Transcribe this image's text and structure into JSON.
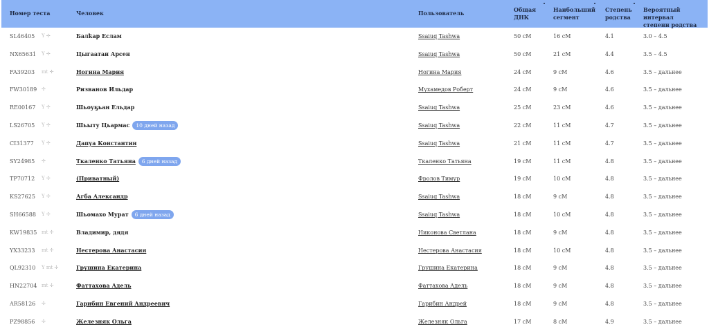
{
  "headers": {
    "test": "Номер теста",
    "person": "Человек",
    "user": "Пользователь",
    "total_l1": "Общая",
    "total_l2": "ДНК",
    "seg_l1": "Наибольший",
    "seg_l2": "сегмент",
    "deg_l1": "Степень",
    "deg_l2": "родства",
    "range_l1": "Вероятный интервал",
    "range_l2": "степени родства"
  },
  "rows": [
    {
      "test": "SL46405",
      "icons": "Y ✢",
      "person": "Балҟар Еслам",
      "link": false,
      "badge": "",
      "user": "Ssaiuq Tashwa",
      "total": "50 cM",
      "seg": "16 cM",
      "deg": "4.1",
      "range": "3.0 – 4.5"
    },
    {
      "test": "NX65631",
      "icons": "Y ✢",
      "person": "Цыгаатан Арсен",
      "link": false,
      "badge": "",
      "user": "Ssaiuq Tashwa",
      "total": "50 cM",
      "seg": "21 cM",
      "deg": "4.4",
      "range": "3.5 – 4.5"
    },
    {
      "test": "FA39203",
      "icons": "mt ✢",
      "person": "Ногина Мария",
      "link": true,
      "badge": "",
      "user": "Ногина Мария",
      "total": "24 cM",
      "seg": "9 cM",
      "deg": "4.6",
      "range": "3.5 – дальнее"
    },
    {
      "test": "FW30189",
      "icons": "✢",
      "person": "Ризванов Ильдар",
      "link": false,
      "badge": "",
      "user": "Мухамедов Роберт",
      "total": "24 cM",
      "seg": "9 cM",
      "deg": "4.6",
      "range": "3.5 – дальнее"
    },
    {
      "test": "RE00167",
      "icons": "Y ✢",
      "person": "Шьоуҕьан Ельдар",
      "link": false,
      "badge": "",
      "user": "Ssaiuq Tashwa",
      "total": "25 cM",
      "seg": "23 cM",
      "deg": "4.6",
      "range": "3.5 – дальнее"
    },
    {
      "test": "LS26705",
      "icons": "Y ✢",
      "person": "Шьыту Цьармас",
      "link": false,
      "badge": "10 дней назад",
      "user": "Ssaiuq Tashwa",
      "total": "22 cM",
      "seg": "11 cM",
      "deg": "4.7",
      "range": "3.5 – дальнее"
    },
    {
      "test": "CI31377",
      "icons": "Y ✢",
      "person": "Дапуа Константин",
      "link": true,
      "badge": "",
      "user": "Ssaiuq Tashwa",
      "total": "21 cM",
      "seg": "11 cM",
      "deg": "4.7",
      "range": "3.5 – дальнее"
    },
    {
      "test": "SY24985",
      "icons": "✢",
      "person": "Ткаленко Татьяна",
      "link": true,
      "badge": "6 дней назад",
      "user": "Ткаленко Татьяна",
      "total": "19 cM",
      "seg": "11 cM",
      "deg": "4.8",
      "range": "3.5 – дальнее"
    },
    {
      "test": "TP70712",
      "icons": "Y ✢",
      "person": "(Приватный)",
      "link": true,
      "badge": "",
      "user": "Фролов Тимур",
      "total": "19 cM",
      "seg": "10 cM",
      "deg": "4.8",
      "range": "3.5 – дальнее"
    },
    {
      "test": "KS27625",
      "icons": "Y ✢",
      "person": "Агба Александр",
      "link": true,
      "badge": "",
      "user": "Ssaiuq Tashwa",
      "total": "18 cM",
      "seg": "9 cM",
      "deg": "4.8",
      "range": "3.5 – дальнее"
    },
    {
      "test": "SH66588",
      "icons": "Y ✢",
      "person": "Шьомахо Мурат",
      "link": false,
      "badge": "6 дней назад",
      "user": "Ssaiuq Tashwa",
      "total": "18 cM",
      "seg": "10 cM",
      "deg": "4.8",
      "range": "3.5 – дальнее"
    },
    {
      "test": "KW19835",
      "icons": "mt ✢",
      "person": "Владимир, дядя",
      "link": false,
      "badge": "",
      "user": "Никонова Светлана",
      "total": "18 cM",
      "seg": "9 cM",
      "deg": "4.8",
      "range": "3.5 – дальнее"
    },
    {
      "test": "YX33233",
      "icons": "mt ✢",
      "person": "Нестерова Анастасия",
      "link": true,
      "badge": "",
      "user": "Нестерова Анастасия",
      "total": "18 cM",
      "seg": "10 cM",
      "deg": "4.8",
      "range": "3.5 – дальнее"
    },
    {
      "test": "QL92310",
      "icons": "Y mt ✢",
      "person": "Грушина Екатерина",
      "link": true,
      "badge": "",
      "user": "Грушина Екатерина",
      "total": "18 cM",
      "seg": "9 cM",
      "deg": "4.8",
      "range": "3.5 – дальнее"
    },
    {
      "test": "HN22704",
      "icons": "mt ✢",
      "person": "Фаттахова Адель",
      "link": true,
      "badge": "",
      "user": "Фаттахова Адель",
      "total": "18 cM",
      "seg": "9 cM",
      "deg": "4.8",
      "range": "3.5 – дальнее"
    },
    {
      "test": "AR58126",
      "icons": "✢",
      "person": "Гарибин Евгений Андреевич",
      "link": true,
      "badge": "",
      "user": "Гарибин Андрей",
      "total": "18 cM",
      "seg": "9 cM",
      "deg": "4.8",
      "range": "3.5 – дальнее"
    },
    {
      "test": "PZ98856",
      "icons": "✢",
      "person": "Железняк Ольга",
      "link": true,
      "badge": "",
      "user": "Железняк Ольга",
      "total": "17 cM",
      "seg": "8 cM",
      "deg": "4.9",
      "range": "3.5 – дальнее"
    }
  ]
}
